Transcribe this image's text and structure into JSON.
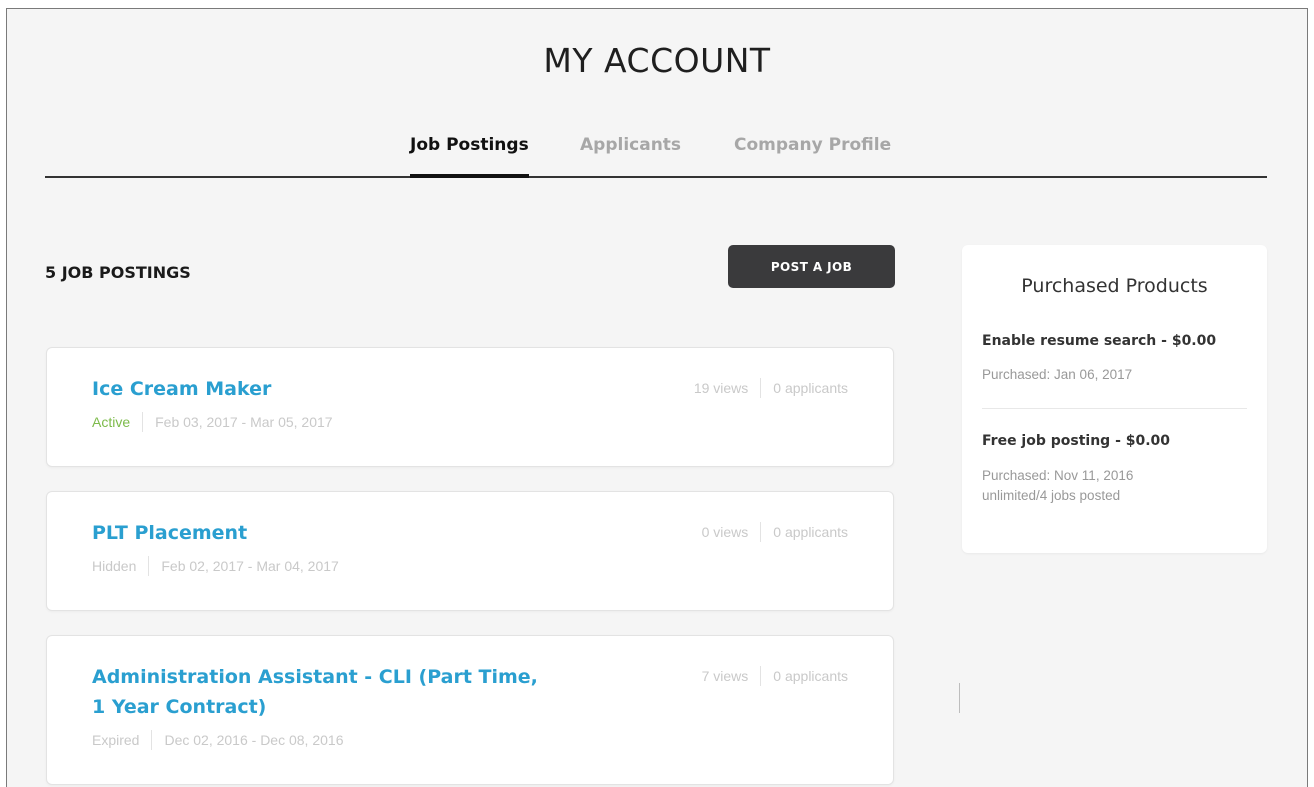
{
  "header": {
    "title": "MY ACCOUNT"
  },
  "tabs": [
    {
      "label": "Job Postings",
      "active": true
    },
    {
      "label": "Applicants",
      "active": false
    },
    {
      "label": "Company Profile",
      "active": false
    }
  ],
  "postings": {
    "count_label": "5 JOB POSTINGS",
    "post_button": "POST A JOB",
    "items": [
      {
        "title": "Ice Cream Maker",
        "status": "Active",
        "dates": "Feb 03, 2017 - Mar 05, 2017",
        "views": "19 views",
        "applicants": "0 applicants"
      },
      {
        "title": "PLT Placement",
        "status": "Hidden",
        "dates": "Feb 02, 2017 - Mar 04, 2017",
        "views": "0 views",
        "applicants": "0 applicants"
      },
      {
        "title": "Administration Assistant - CLI (Part Time, 1 Year Contract)",
        "status": "Expired",
        "dates": "Dec 02, 2016 - Dec 08, 2016",
        "views": "7 views",
        "applicants": "0 applicants"
      }
    ]
  },
  "sidebar": {
    "title": "Purchased Products",
    "products": [
      {
        "name": "Enable resume search - $0.00",
        "purchased": "Purchased: Jan 06, 2017",
        "extra": ""
      },
      {
        "name": "Free job posting - $0.00",
        "purchased": "Purchased: Nov 11, 2016",
        "extra": "unlimited/4 jobs posted"
      }
    ]
  },
  "colors": {
    "link": "#2a9fd0",
    "active_status": "#7dbb4b",
    "button_bg": "#3a3a3c"
  }
}
